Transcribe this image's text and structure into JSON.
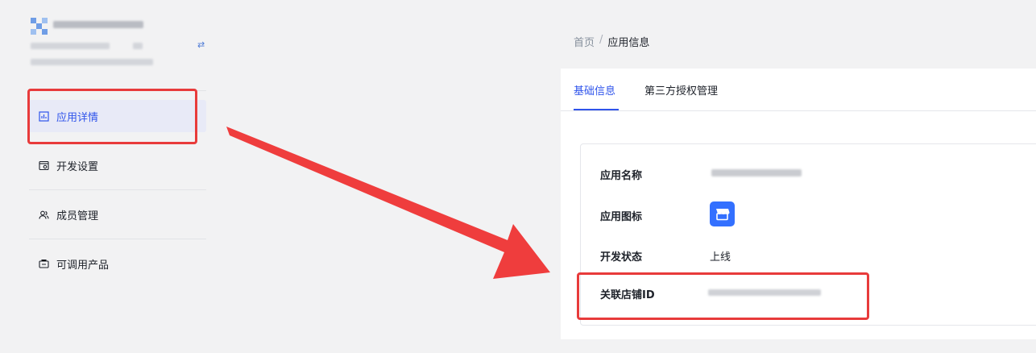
{
  "sidebar": {
    "items": [
      {
        "label": "应用详情",
        "icon": "chart-panel-icon",
        "active": true
      },
      {
        "label": "开发设置",
        "icon": "gear-window-icon"
      },
      {
        "label": "成员管理",
        "icon": "users-icon"
      },
      {
        "label": "可调用产品",
        "icon": "product-box-icon"
      }
    ],
    "switch_glyph": "⇄"
  },
  "breadcrumb": {
    "home": "首页",
    "separator": "/",
    "current": "应用信息"
  },
  "tabs": [
    {
      "label": "基础信息",
      "active": true
    },
    {
      "label": "第三方授权管理"
    }
  ],
  "info": {
    "app_name_label": "应用名称",
    "app_icon_label": "应用图标",
    "dev_status_label": "开发状态",
    "dev_status_value": "上线",
    "store_id_label": "关联店铺ID"
  },
  "colors": {
    "accent": "#2f54eb",
    "highlight": "#e83b3b",
    "store_icon": "#3370ff"
  }
}
